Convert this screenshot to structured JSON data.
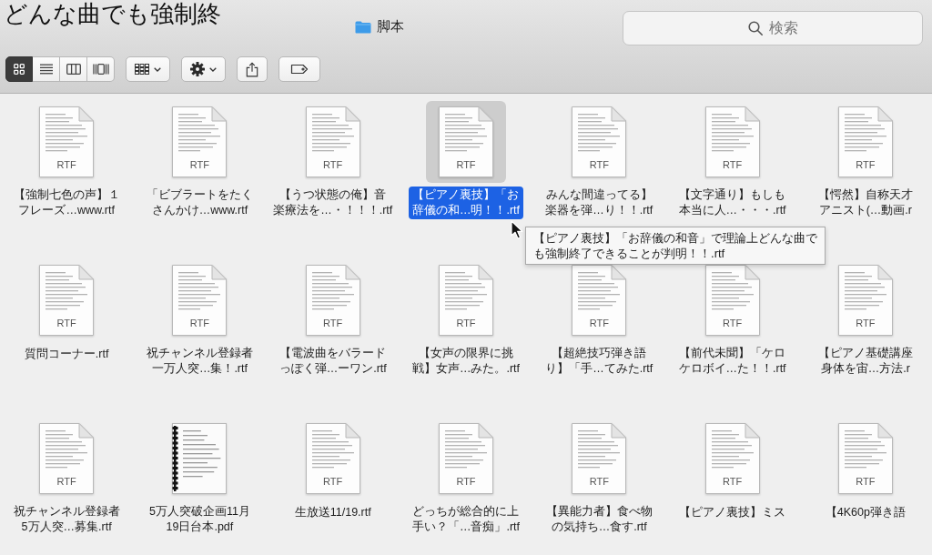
{
  "background_window": {
    "text": "どんな曲でも強制終"
  },
  "window": {
    "title": "脚本"
  },
  "search": {
    "placeholder": "検索"
  },
  "views": [
    {
      "kind": "icon",
      "selected": true
    },
    {
      "kind": "list",
      "selected": false
    },
    {
      "kind": "column",
      "selected": false
    },
    {
      "kind": "gallery",
      "selected": false
    }
  ],
  "files": [
    {
      "kind": "rtf",
      "badge": "RTF",
      "lines": [
        "【強制七色の声】１",
        "フレーズ…www.rtf"
      ],
      "selected": false
    },
    {
      "kind": "rtf",
      "badge": "RTF",
      "lines": [
        "「ビブラートをたく",
        "さんかけ…www.rtf"
      ],
      "selected": false
    },
    {
      "kind": "rtf",
      "badge": "RTF",
      "lines": [
        "【うつ状態の俺】音",
        "楽療法を…・！！！.rtf"
      ],
      "selected": false
    },
    {
      "kind": "rtf",
      "badge": "RTF",
      "lines": [
        "【ピアノ裏技】「お",
        "辞儀の和…明！！.rtf"
      ],
      "selected": true
    },
    {
      "kind": "rtf",
      "badge": "RTF",
      "lines": [
        "みんな間違ってる】",
        "楽器を弾…り！！.rtf"
      ],
      "selected": false
    },
    {
      "kind": "rtf",
      "badge": "RTF",
      "lines": [
        "【文字通り】もしも",
        "本当に人…・・・.rtf"
      ],
      "selected": false
    },
    {
      "kind": "rtf",
      "badge": "RTF",
      "lines": [
        "【愕然】自称天才",
        "アニスト(…動画.r"
      ],
      "selected": false
    },
    {
      "kind": "rtf",
      "badge": "RTF",
      "lines": [
        "質問コーナー.rtf"
      ],
      "selected": false
    },
    {
      "kind": "rtf",
      "badge": "RTF",
      "lines": [
        "祝チャンネル登録者",
        "一万人突…集！.rtf"
      ],
      "selected": false
    },
    {
      "kind": "rtf",
      "badge": "RTF",
      "lines": [
        "【電波曲をバラード",
        "っぽく弾…ーワン.rtf"
      ],
      "selected": false
    },
    {
      "kind": "rtf",
      "badge": "RTF",
      "lines": [
        "【女声の限界に挑",
        "戦】女声…みた。.rtf"
      ],
      "selected": false
    },
    {
      "kind": "rtf",
      "badge": "RTF",
      "lines": [
        "【超絶技巧弾き語",
        "り】「手…てみた.rtf"
      ],
      "selected": false
    },
    {
      "kind": "rtf",
      "badge": "RTF",
      "lines": [
        "【前代未聞】「ケロ",
        "ケロボイ…た！！.rtf"
      ],
      "selected": false
    },
    {
      "kind": "rtf",
      "badge": "RTF",
      "lines": [
        "【ピアノ基礎講座",
        "身体を宙…方法.r"
      ],
      "selected": false
    },
    {
      "kind": "rtf",
      "badge": "RTF",
      "lines": [
        "祝チャンネル登録者",
        "5万人突…募集.rtf"
      ],
      "selected": false
    },
    {
      "kind": "pdf",
      "lines": [
        "5万人突破企画11月",
        "19日台本.pdf"
      ],
      "selected": false
    },
    {
      "kind": "rtf",
      "badge": "RTF",
      "lines": [
        "生放送11/19.rtf"
      ],
      "selected": false
    },
    {
      "kind": "rtf",
      "badge": "RTF",
      "lines": [
        "どっちが総合的に上",
        "手い？「…音痴」.rtf"
      ],
      "selected": false
    },
    {
      "kind": "rtf",
      "badge": "RTF",
      "lines": [
        "【異能力者】食べ物",
        "の気持ち…食す.rtf"
      ],
      "selected": false
    },
    {
      "kind": "rtf",
      "badge": "RTF",
      "lines": [
        "【ピアノ裏技】ミス"
      ],
      "selected": false
    },
    {
      "kind": "rtf",
      "badge": "RTF",
      "lines": [
        "【4K60p弾き語"
      ],
      "selected": false
    }
  ],
  "tooltip": {
    "lines": [
      "【ピアノ裏技】「お辞儀の和音」で理論上どんな曲で",
      "も強制終了できることが判明！！.rtf"
    ]
  }
}
